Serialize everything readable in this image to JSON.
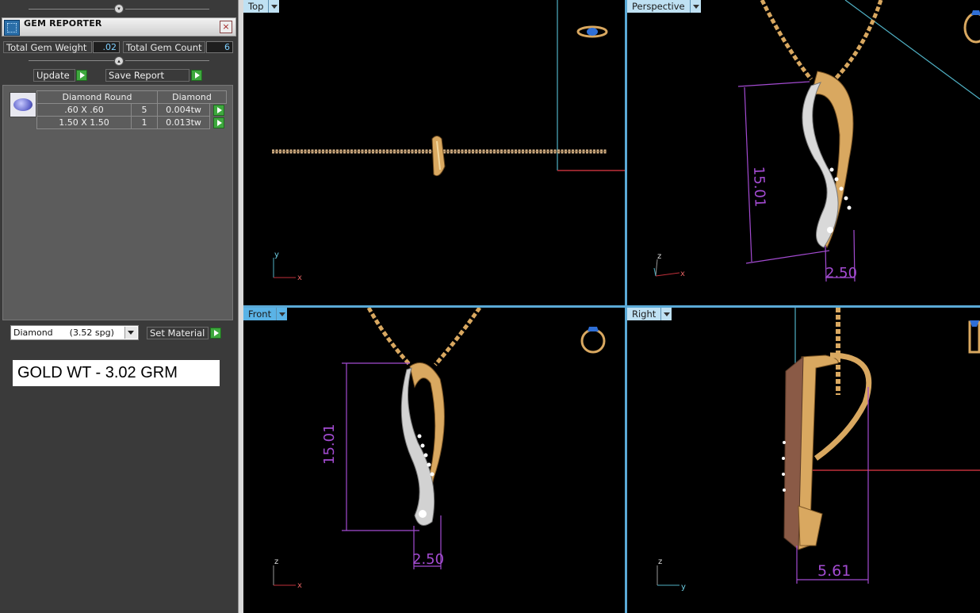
{
  "gem_reporter": {
    "title": "GEM REPORTER",
    "total_weight_label": "Total Gem Weight",
    "total_weight_value": ".02",
    "total_count_label": "Total Gem Count",
    "total_count_value": "6",
    "update_label": "Update",
    "save_report_label": "Save Report",
    "table": {
      "headers": [
        "Diamond Round",
        "Diamond"
      ],
      "rows": [
        {
          "size": ".60 X .60",
          "count": "5",
          "weight": "0.004tw"
        },
        {
          "size": "1.50 X 1.50",
          "count": "1",
          "weight": "0.013tw"
        }
      ]
    },
    "material_select": "Diamond      (3.52 spg)",
    "set_material_label": "Set Material",
    "gold_weight_note": "GOLD WT - 3.02 GRM"
  },
  "viewports": {
    "top": {
      "label": "Top"
    },
    "perspective": {
      "label": "Perspective",
      "dimension_height": "15.01",
      "dimension_width": "2.50"
    },
    "front": {
      "label": "Front",
      "dimension_height": "15.01",
      "dimension_width": "2.50"
    },
    "right": {
      "label": "Right",
      "dimension_depth": "5.61"
    }
  },
  "axes": {
    "x": "x",
    "y": "y",
    "z": "z"
  },
  "colors": {
    "dimension": "#a34bd1",
    "gold": "#d9a860",
    "white_gold": "#d8d8d8",
    "viewport_label": "#bfe1f3",
    "viewport_label_active": "#5ab3e6",
    "panel_bg": "#3a3a3a"
  }
}
